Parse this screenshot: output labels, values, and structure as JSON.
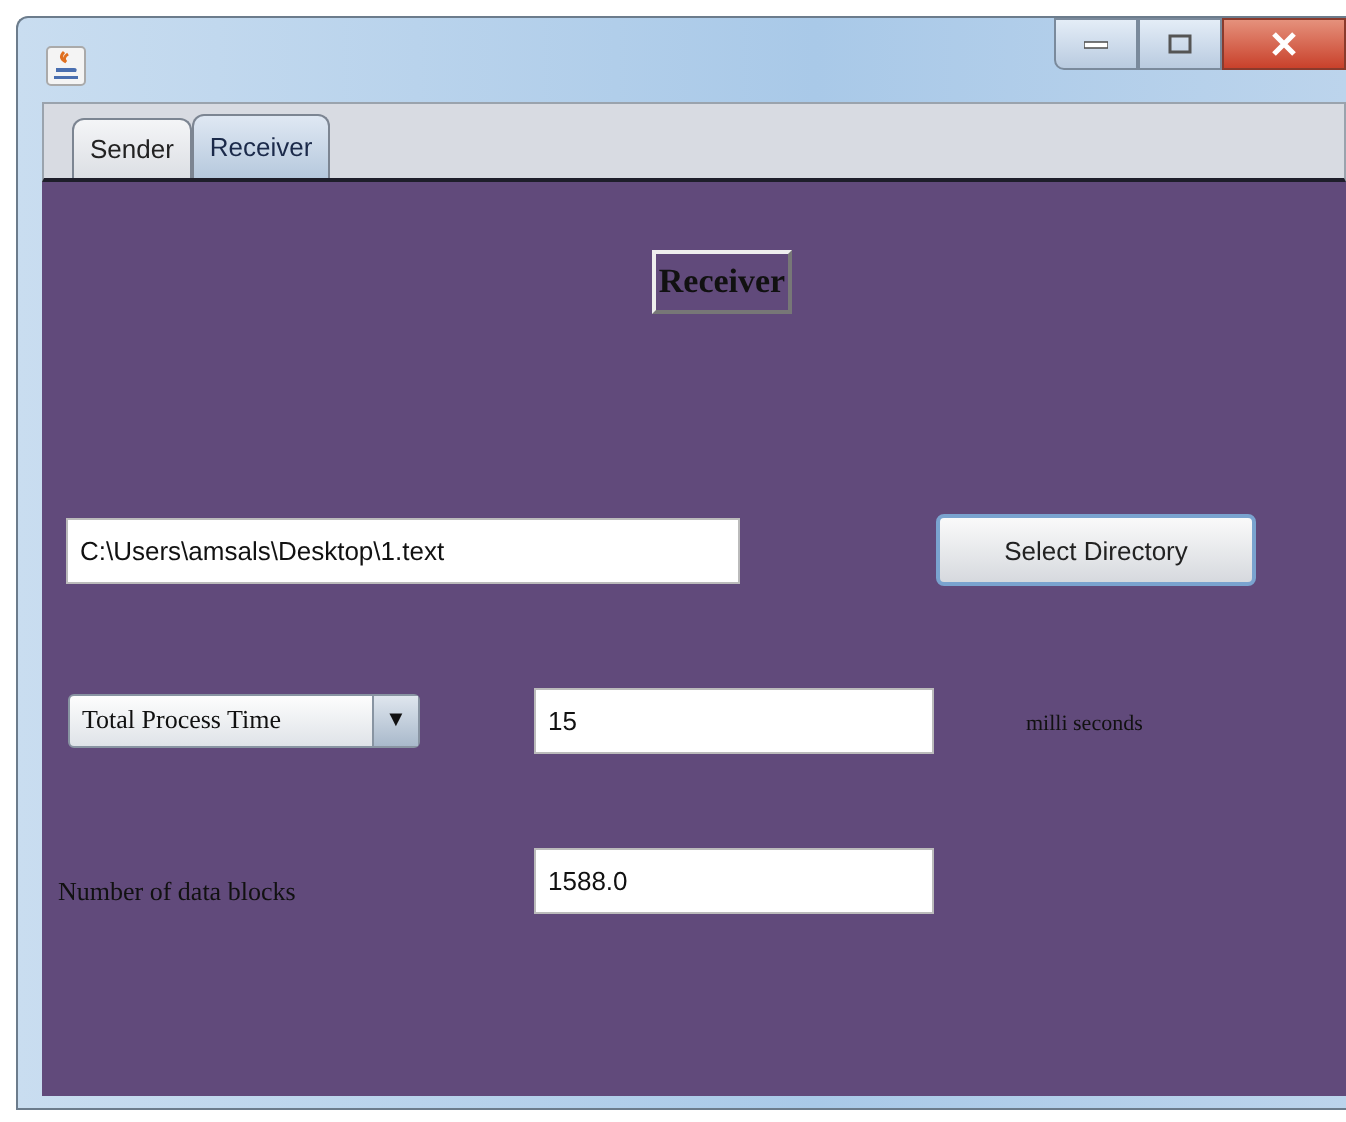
{
  "tabs": [
    {
      "label": "Sender",
      "selected": false
    },
    {
      "label": "Receiver",
      "selected": true
    }
  ],
  "heading": "Receiver",
  "path_field": {
    "value": "C:\\Users\\amsals\\Desktop\\1.text"
  },
  "select_button": "Select Directory",
  "measure_dropdown": {
    "value": "Total Process Time",
    "arrow": "▼"
  },
  "time_field": {
    "value": "15"
  },
  "time_unit": "milli seconds",
  "blocks_label": "Number of data blocks",
  "blocks_field": {
    "value": "1588.0"
  }
}
